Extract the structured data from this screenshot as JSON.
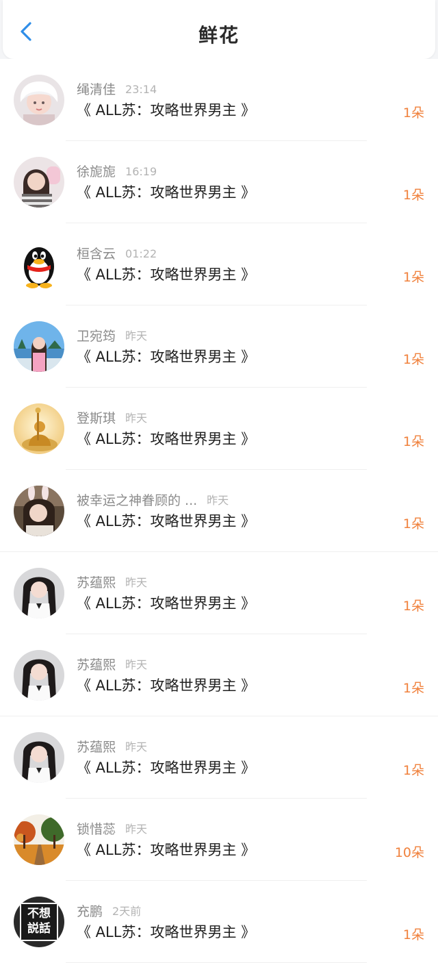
{
  "header": {
    "title": "鲜花",
    "back_icon": "chevron-left-icon",
    "accent_color": "#2f8ee8"
  },
  "colors": {
    "count": "#f0813c",
    "name": "#8a8a8a",
    "time": "#b3b3b3"
  },
  "items": [
    {
      "name": "绳清佳",
      "time": "23:14",
      "book": "《 ALL苏：攻略世界男主 》",
      "count": "1朵",
      "avatar": "girl-white-hair"
    },
    {
      "name": "徐旎旎",
      "time": "16:19",
      "book": "《 ALL苏：攻略世界男主 》",
      "count": "1朵",
      "avatar": "girl-dark-hair"
    },
    {
      "name": "桓含云",
      "time": "01:22",
      "book": "《 ALL苏：攻略世界男主 》",
      "count": "1朵",
      "avatar": "penguin"
    },
    {
      "name": "卫宛筠",
      "time": "昨天",
      "book": "《 ALL苏：攻略世界男主 》",
      "count": "1朵",
      "avatar": "girl-sky"
    },
    {
      "name": "登斯琪",
      "time": "昨天",
      "book": "《 ALL苏：攻略世界男主 》",
      "count": "1朵",
      "avatar": "golden-buddha"
    },
    {
      "name": "被幸运之神眷顾的 ...",
      "time": "昨天",
      "book": "《 ALL苏：攻略世界男主 》",
      "count": "1朵",
      "avatar": "girl-bunny-ears"
    },
    {
      "name": "苏蕴熙",
      "time": "昨天",
      "book": "《 ALL苏：攻略世界男主 》",
      "count": "1朵",
      "avatar": "girl-twin-tails"
    },
    {
      "name": "苏蕴熙",
      "time": "昨天",
      "book": "《 ALL苏：攻略世界男主 》",
      "count": "1朵",
      "avatar": "girl-twin-tails"
    },
    {
      "name": "苏蕴熙",
      "time": "昨天",
      "book": "《 ALL苏：攻略世界男主 》",
      "count": "1朵",
      "avatar": "girl-twin-tails"
    },
    {
      "name": "锁惜蕊",
      "time": "昨天",
      "book": "《 ALL苏：攻略世界男主 》",
      "count": "10朵",
      "avatar": "autumn-road"
    },
    {
      "name": "充鹏",
      "time": "2天前",
      "book": "《 ALL苏：攻略世界男主 》",
      "count": "1朵",
      "avatar": "text-sign",
      "avatar_text": "不想 説話"
    }
  ]
}
